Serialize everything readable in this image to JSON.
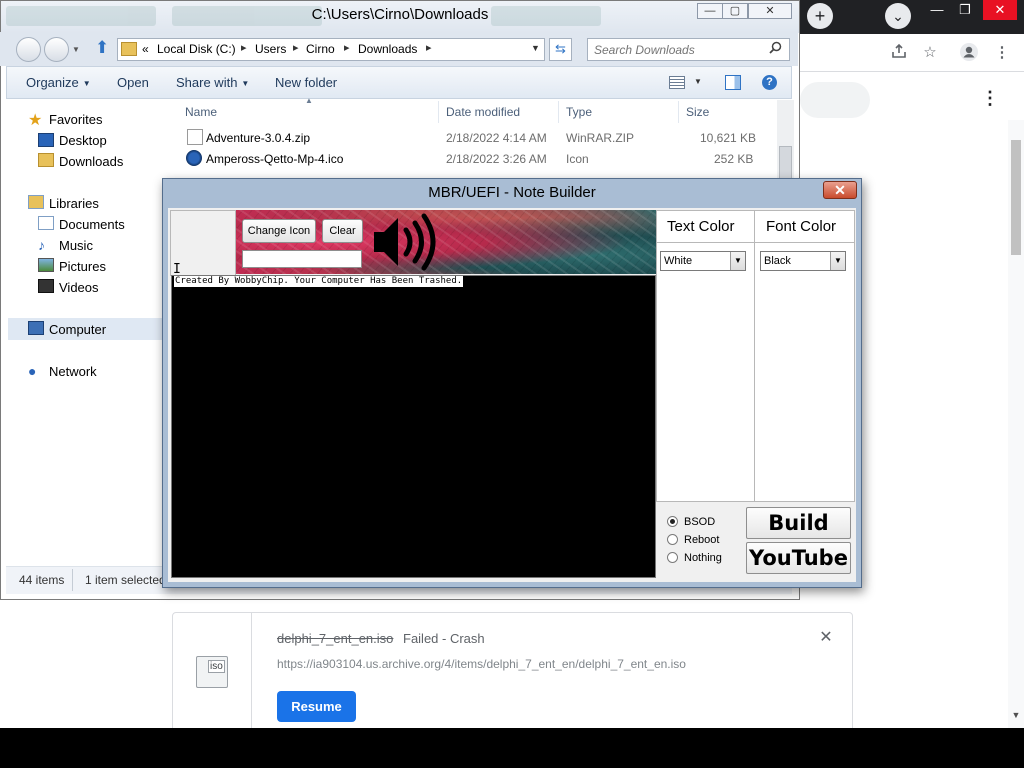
{
  "chrome": {
    "new_tab_symbol": "+",
    "tab_search_symbol": "⌄",
    "window_controls": [
      "—",
      "❐",
      "✕"
    ],
    "menu_symbol": "⋮",
    "download": {
      "file_name": "delphi_7_ent_en.iso",
      "status": "Failed - Crash",
      "url": "https://ia903104.us.archive.org/4/items/delphi_7_ent_en/delphi_7_ent_en.iso",
      "resume_label": "Resume",
      "close_symbol": "✕",
      "file_badge": "iso"
    },
    "accent_color": "#1a73e8"
  },
  "explorer": {
    "title": "C:\\Users\\Cirno\\Downloads",
    "window_controls": [
      "—",
      "▢",
      "✕"
    ],
    "breadcrumb": {
      "overflow": "«",
      "items": [
        "Local Disk (C:)",
        "Users",
        "Cirno",
        "Downloads"
      ],
      "separator": "▸"
    },
    "search_placeholder": "Search Downloads",
    "toolbar": {
      "organize": "Organize",
      "open": "Open",
      "share_with": "Share with",
      "new_folder": "New folder",
      "help": "?"
    },
    "nav": {
      "favorites": "Favorites",
      "desktop": "Desktop",
      "downloads": "Downloads",
      "libraries": "Libraries",
      "documents": "Documents",
      "music": "Music",
      "pictures": "Pictures",
      "videos": "Videos",
      "computer": "Computer",
      "network": "Network"
    },
    "columns": [
      "Name",
      "Date modified",
      "Type",
      "Size"
    ],
    "files": [
      {
        "name": "Adventure-3.0.4.zip",
        "date": "2/18/2022 4:14 AM",
        "type": "WinRAR.ZIP",
        "size": "10,621 KB"
      },
      {
        "name": "Ampeross-Qetto-Mp-4.ico",
        "date": "2/18/2022 3:26 AM",
        "type": "Icon",
        "size": "252 KB"
      }
    ],
    "status": {
      "count": "44 items",
      "selected": "1 item selected"
    }
  },
  "note_builder": {
    "title": "MBR/UEFI - Note Builder",
    "close_symbol": "✕",
    "change_icon_label": "Change Icon",
    "clear_label": "Clear",
    "icon_path_value": "",
    "cursor_symbol": "I",
    "note_text": "Created By WobbyChip. Your Computer Has Been Trashed.",
    "text_color_title": "Text Color",
    "font_color_title": "Font Color",
    "text_color_value": "White",
    "font_color_value": "Black",
    "options": [
      {
        "label": "BSOD",
        "checked": true
      },
      {
        "label": "Reboot",
        "checked": false
      },
      {
        "label": "Nothing",
        "checked": false
      }
    ],
    "build_label": "Build",
    "youtube_label": "YouTube"
  }
}
